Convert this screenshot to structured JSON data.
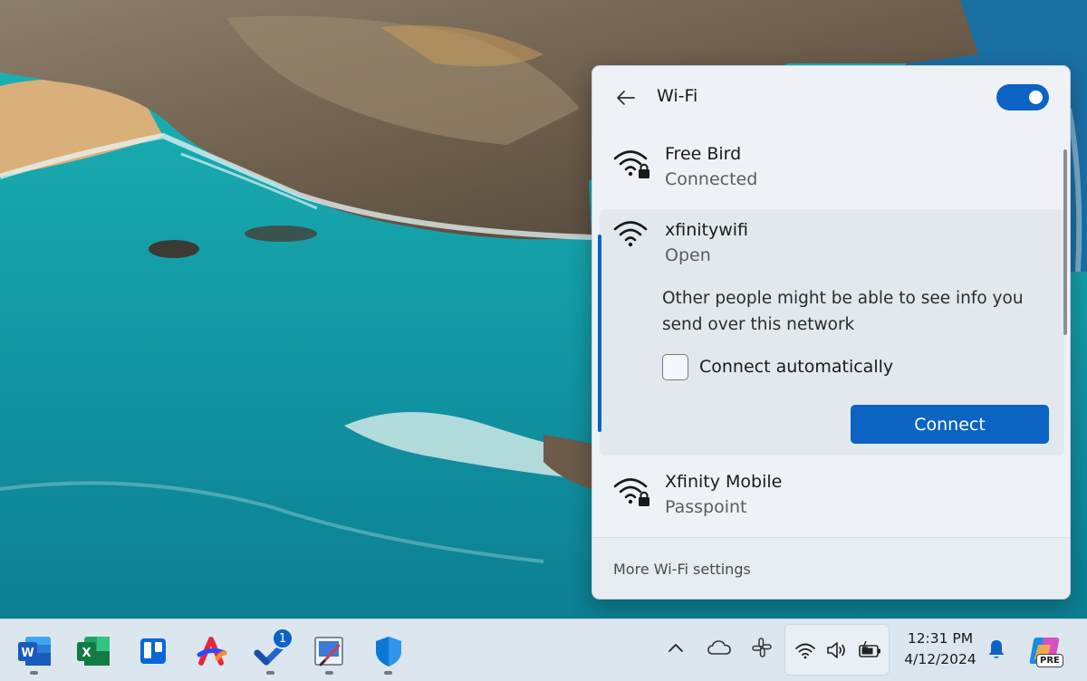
{
  "wifi_panel": {
    "title": "Wi-Fi",
    "wifi_enabled": true,
    "networks": [
      {
        "name": "Free Bird",
        "status": "Connected",
        "secured": true
      },
      {
        "name": "xfinitywifi",
        "status": "Open",
        "secured": false,
        "warning": "Other people might be able to see info you send over this network",
        "connect_automatically_label": "Connect automatically",
        "connect_automatically_checked": false,
        "connect_button_label": "Connect"
      },
      {
        "name": "Xfinity Mobile",
        "status": "Passpoint",
        "secured": true
      }
    ],
    "footer_link": "More Wi-Fi settings",
    "accent_color": "#0c63c4"
  },
  "taskbar": {
    "apps": [
      {
        "name": "Word",
        "letter": "W",
        "color": "#185abd"
      },
      {
        "name": "Excel",
        "letter": "X",
        "color": "#107c41"
      },
      {
        "name": "Trello",
        "color": "#0b66d6"
      },
      {
        "name": "Arc",
        "color": "#e5283d"
      },
      {
        "name": "Microsoft To Do",
        "badge": "1",
        "color": "#2564cf"
      },
      {
        "name": "Snipping Tool",
        "color": "#1d6fc9"
      },
      {
        "name": "Windows Security",
        "color": "#0a78d4"
      }
    ],
    "tray_icons": [
      "chevron-up-icon",
      "onedrive-icon",
      "slack-icon",
      "wifi-icon",
      "volume-icon",
      "battery-icon"
    ],
    "clock": {
      "time": "12:31 PM",
      "date": "4/12/2024"
    },
    "copilot_label": "PRE"
  }
}
